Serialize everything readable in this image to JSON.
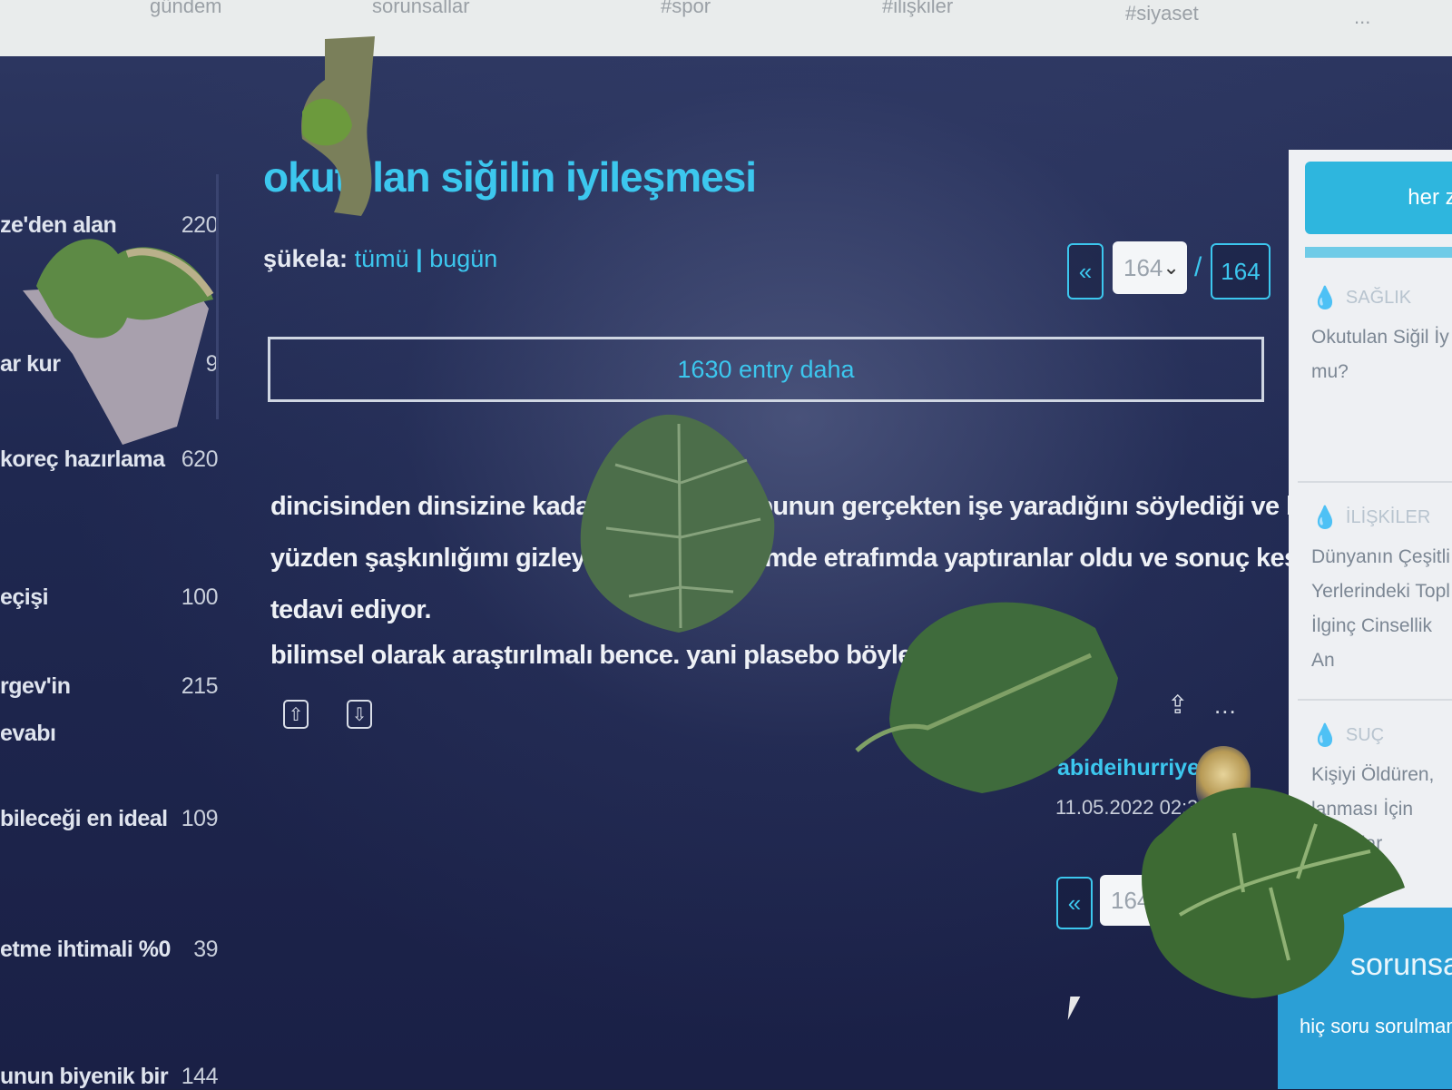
{
  "topnav": {
    "items": [
      "gündem",
      "sorunsallar",
      "#spor",
      "#ilişkiler",
      "#siyaset",
      "..."
    ]
  },
  "sidebar": {
    "items": [
      {
        "label": "ze'den alan",
        "count": "220"
      },
      {
        "label": "ar kur",
        "count": "9"
      },
      {
        "label": "koreç hazırlama",
        "count": "620"
      },
      {
        "label": "eçişi",
        "count": "100"
      },
      {
        "label": "rgev'in",
        "count": "215"
      },
      {
        "label": "evabı",
        "count": ""
      },
      {
        "label": "bileceği en ideal",
        "count": "109"
      },
      {
        "label": "etme ihtimali %0",
        "count": "39"
      },
      {
        "label": "unun biyenik bir",
        "count": "144"
      }
    ]
  },
  "topic": {
    "title": "okutulan siğilin iyileşmesi",
    "sukela_label": "şükela:",
    "sukela_all": "tümü",
    "sukela_sep": "|",
    "sukela_today": "bugün"
  },
  "pager": {
    "prev": "«",
    "current": "164",
    "slash": "/",
    "total": "164",
    "chevron": "⌄"
  },
  "more_entries": "1630 entry daha",
  "entry": {
    "line1": "dincisinden dinsizine kadar h                    bunun gerçekten işe yaradığını söylediği ve bu",
    "line2": "yüzden şaşkınlığımı gizleyem                    imde etrafımda yaptıranlar oldu ve sonuç kesin,",
    "line3": "tedavi ediyor.",
    "line4": "bilimsel olarak araştırılmalı bence. yani plasebo böyle bir şey",
    "upvote": "⇧",
    "downvote": "⇩",
    "share": "⇪",
    "more": "...",
    "author": "abideihurriyet",
    "date": "11.05.2022 02:34"
  },
  "pager_bottom": {
    "prev": "«",
    "current": "164"
  },
  "right": {
    "top_button": "her za",
    "cards": [
      {
        "category": "SAĞLIK",
        "title": "Okutulan Siğil İy\nmu?"
      },
      {
        "category": "İLİŞKİLER",
        "title": "Dünyanın Çeşitli\nYerlerindeki Topl\nİlginç Cinsellik An"
      },
      {
        "category": "SUÇ",
        "title": "Kişiyi Öldüren,\nlanması İçin\nca Dolar"
      }
    ],
    "bottom_title": "sorunsallar",
    "bottom_sub": "hiç soru sorulmamı"
  },
  "colors": {
    "accent": "#3cc7ee",
    "screen_bg": "#1f2850",
    "right_button": "#2eb6de"
  }
}
